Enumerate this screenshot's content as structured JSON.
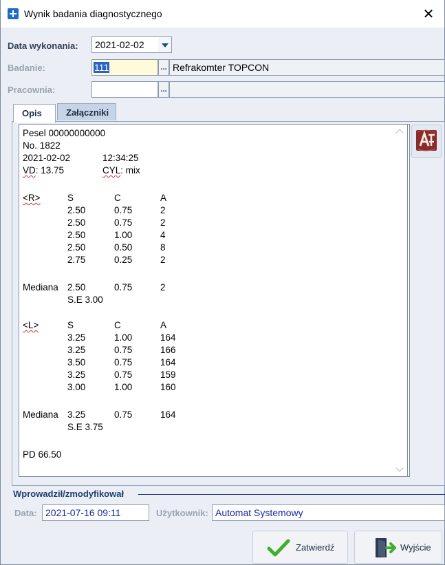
{
  "window": {
    "title": "Wynik badania diagnostycznego",
    "close_glyph": "✕"
  },
  "form": {
    "data_wykonania": {
      "label": "Data wykonania:",
      "value": "2021-02-02"
    },
    "badanie": {
      "label": "Badanie:",
      "code": "111",
      "name": "Refrakomter TOPCON",
      "ellipsis": "..."
    },
    "pracownia": {
      "label": "Pracownia:",
      "value": "",
      "ellipsis": "..."
    }
  },
  "tabs": [
    {
      "label": "Opis",
      "active": true
    },
    {
      "label": "Załączniki",
      "active": false
    }
  ],
  "opis": {
    "header": {
      "pesel": "Pesel 00000000000",
      "no": "No. 1822",
      "date": "2021-02-02",
      "time": "12:34:25",
      "vd_prefix": "VD",
      "vd_value": ": 13.75",
      "cyl_prefix": "CYL",
      "cyl_value": ": mix"
    },
    "right": {
      "tag": "<R>",
      "headers": [
        "S",
        "C",
        "A"
      ],
      "rows": [
        [
          "2.50",
          "0.75",
          "2"
        ],
        [
          "2.50",
          "0.75",
          "2"
        ],
        [
          "2.50",
          "1.00",
          "4"
        ],
        [
          "2.50",
          "0.50",
          "8"
        ],
        [
          "2.75",
          "0.25",
          "2"
        ]
      ],
      "mediana_label": "Mediana",
      "mediana": [
        "2.50",
        "0.75",
        "2"
      ],
      "se": "S.E 3.00"
    },
    "left": {
      "tag": "<L>",
      "headers": [
        "S",
        "C",
        "A"
      ],
      "rows": [
        [
          "3.25",
          "1.00",
          "164"
        ],
        [
          "3.25",
          "0.75",
          "166"
        ],
        [
          "3.50",
          "0.75",
          "164"
        ],
        [
          "3.25",
          "0.75",
          "159"
        ],
        [
          "3.00",
          "1.00",
          "160"
        ]
      ],
      "mediana_label": "Mediana",
      "mediana": [
        "3.25",
        "0.75",
        "164"
      ],
      "se": "S.E 3.75"
    },
    "pd": "PD 66.50"
  },
  "footer": {
    "section_title": "Wprowadził/zmodyfikował",
    "data_label": "Data:",
    "data_value": "2021-07-16 09:11",
    "user_label": "Użytkownik:",
    "user_value": "Automat Systemowy"
  },
  "buttons": {
    "confirm": "Zatwierdź",
    "exit": "Wyjście"
  },
  "colors": {
    "accent": "#1f3d6e",
    "code_highlight": "#fffbd9",
    "check_green": "#3fae2a"
  },
  "icons": [
    "add-icon",
    "close-icon",
    "chevron-down-icon",
    "logo-icon",
    "check-icon",
    "exit-door-icon"
  ]
}
